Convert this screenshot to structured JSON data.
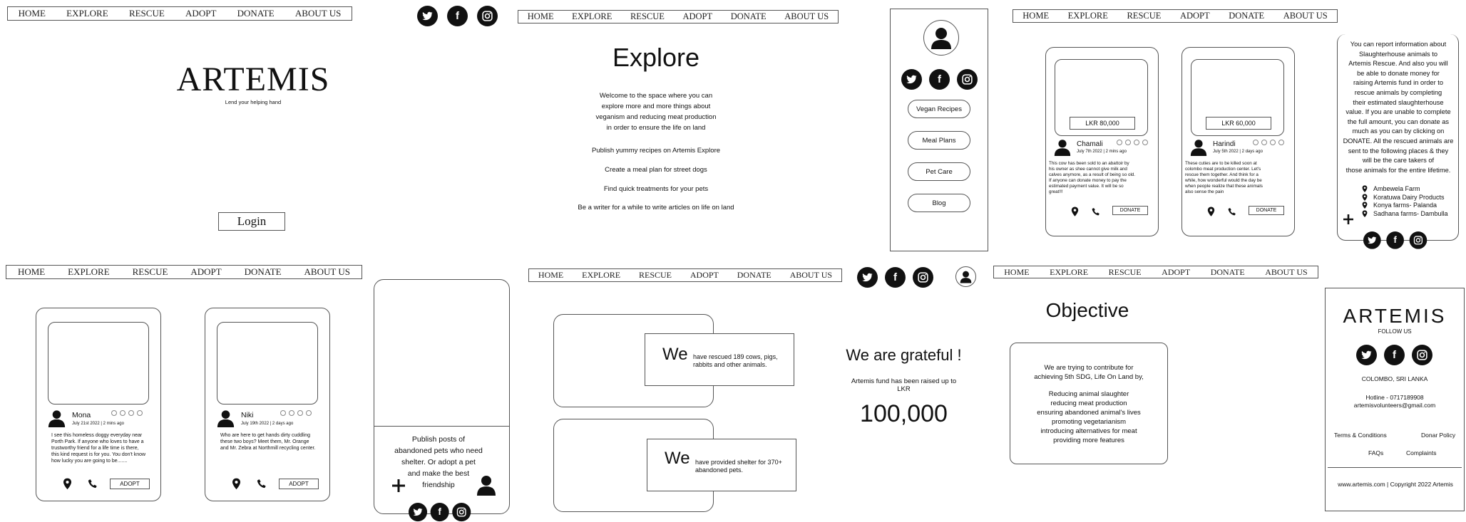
{
  "nav": [
    "HOME",
    "EXPLORE",
    "RESCUE",
    "ADOPT",
    "DONATE",
    "ABOUT US"
  ],
  "social": [
    {
      "name": "twitter-icon",
      "glyph": ""
    },
    {
      "name": "facebook-icon",
      "glyph": "f"
    },
    {
      "name": "instagram-icon",
      "glyph": ""
    }
  ],
  "home": {
    "brand": "ARTEMIS",
    "tagline": "Lend your helping hand",
    "login": "Login"
  },
  "explore": {
    "title": "Explore",
    "intro": [
      "Welcome to the space where you can",
      "explore more and more things about",
      "veganism and reducing meat production",
      "in order to ensure the life on land"
    ],
    "items": [
      "Publish yummy recipes on Artemis Explore",
      "Create a meal plan for street dogs",
      "Find quick treatments for your pets",
      "Be a writer for a while to write articles on life on land"
    ]
  },
  "menu": {
    "buttons": [
      "Vegan Recipes",
      "Meal Plans",
      "Pet Care",
      "Blog"
    ]
  },
  "rescue": {
    "cards": [
      {
        "price": "LKR 80,000",
        "name": "Chamali",
        "date": "July 7th 2022 | 2 mins ago",
        "text": [
          "This cow has been sold to an abattoir by",
          "his owner as shee cannot give milk and",
          "calves anymore, as a result of being so old.",
          "If anyone can donate money to pay the",
          "estimated payment value. It will be so",
          "great!!!"
        ],
        "button": "DONATE"
      },
      {
        "price": "LKR 60,000",
        "name": "Harindi",
        "date": "July 5th 2022 | 2 days ago",
        "text": [
          "These cuties are to be killed soon at",
          "colombo meat production center. Let's",
          "rescue them together. And think for a",
          "while, how wonderful would the day be",
          "when people realize that these animals",
          "also sense the pain"
        ],
        "button": "DONATE"
      }
    ]
  },
  "rescueInfo": {
    "text": [
      "You can report information about",
      "Slaughterhouse animals to",
      "Artemis Rescue. And also you will",
      "be able to donate money for",
      "raising Artemis fund in order to",
      "rescue animals by completing",
      "their estimated slaughterhouse",
      "value. If you are unable to complete",
      "the full amount, you can donate as",
      "much as you can by clicking on",
      "DONATE. All the rescued animals are",
      "sent to the following places & they",
      "will be the care takers of",
      "those animals for the entire lifetime."
    ],
    "places": [
      "Ambewela Farm",
      "Koratuwa Dairy Products",
      "Konya farms- Palanda",
      "Sadhana farms- Dambulla"
    ]
  },
  "adopt": {
    "cards": [
      {
        "name": "Mona",
        "date": "July 21st 2022 | 2 mins ago",
        "text": [
          "I see this homeless doggy everyday near",
          "Porth Park. If anyone who loves to have a",
          "trustworthy friend for a life time is there,",
          "this kind request is for you. You don't know",
          "how lucky you are going to be......."
        ],
        "button": "ADOPT"
      },
      {
        "name": "Niki",
        "date": "July 19th 2022 | 2 days ago",
        "text": [
          "Who are here to get hands dirty cuddling",
          "these two boys? Meet them, Mr. Orange",
          "and Mr. Zebra at Northmill recycling center."
        ],
        "button": "ADOPT"
      }
    ],
    "postText": [
      "Publish posts of",
      "abandoned pets who need",
      "shelter. Or adopt a pet",
      "and make the best",
      "friendship"
    ]
  },
  "about": {
    "we": "We",
    "stat1": [
      "have rescued 189 cows, pigs,",
      "rabbits and other animals."
    ],
    "stat2": [
      "have provided shelter for 370+",
      "abandoned pets."
    ],
    "grateful": "We are grateful !",
    "fundText": [
      "Artemis fund has been raised up to",
      "LKR"
    ],
    "amount": "100,000"
  },
  "objective": {
    "title": "Objective",
    "lead": [
      "We are trying to contribute for",
      "achieving 5th SDG, Life On Land by,"
    ],
    "items": [
      "Reducing animal slaughter",
      "reducing meat production",
      "ensuring abandoned animal's lives",
      "promoting vegetarianism",
      "introducing alternatives for meat",
      "providing more features"
    ]
  },
  "footer": {
    "brand": "ARTEMIS",
    "follow": "FOLLOW US",
    "location": "COLOMBO, SRI LANKA",
    "hotline": "Hotline - 0717189908",
    "email": "artemisvolunteers@gmail.com",
    "links": [
      "Terms & Conditions",
      "Donar Policy",
      "FAQs",
      "Complaints"
    ],
    "copyright": "www.artemis.com | Copyright 2022 Artemis"
  }
}
